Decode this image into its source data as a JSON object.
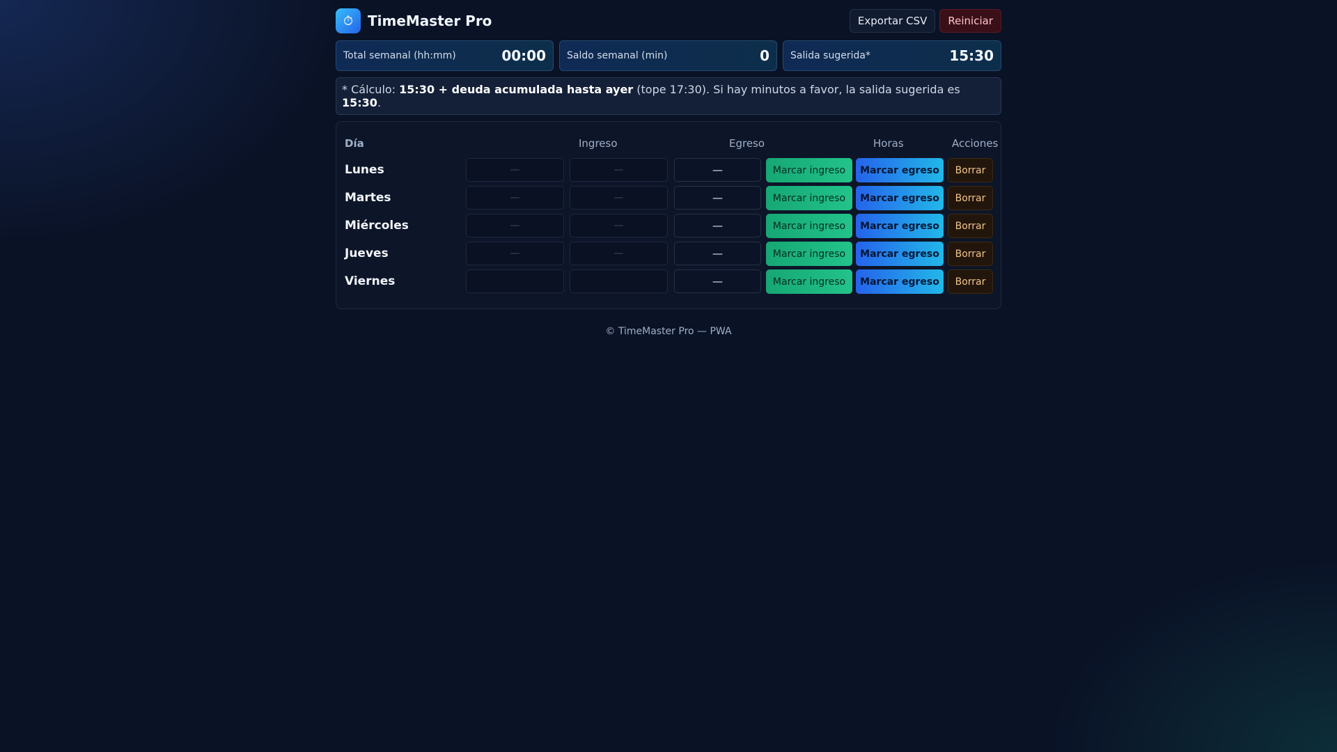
{
  "app": {
    "title": "TimeMaster Pro",
    "logo_icon": "stopwatch-icon",
    "logo_glyph": "⏱"
  },
  "header": {
    "export_label": "Exportar CSV",
    "reset_label": "Reiniciar"
  },
  "stats": [
    {
      "label": "Total semanal (hh:mm)",
      "value": "00:00"
    },
    {
      "label": "Saldo semanal (min)",
      "value": "0"
    },
    {
      "label": "Salida sugerida*",
      "value": "15:30"
    }
  ],
  "note": {
    "prefix": "* Cálculo: ",
    "bold1": "15:30 + deuda acumulada hasta ayer",
    "middle": " (tope 17:30). Si hay minutos a favor, la salida sugerida es ",
    "bold2": "15:30",
    "suffix": "."
  },
  "table": {
    "headers": {
      "dia": "Día",
      "ingreso": "Ingreso",
      "egreso": "Egreso",
      "horas": "Horas",
      "acciones": "Acciones"
    },
    "rows": [
      {
        "day": "Lunes",
        "ingreso": "—",
        "egreso": "—",
        "horas": "—"
      },
      {
        "day": "Martes",
        "ingreso": "—",
        "egreso": "—",
        "horas": "—"
      },
      {
        "day": "Miércoles",
        "ingreso": "—",
        "egreso": "—",
        "horas": "—"
      },
      {
        "day": "Jueves",
        "ingreso": "—",
        "egreso": "—",
        "horas": "—"
      },
      {
        "day": "Viernes",
        "ingreso": "",
        "egreso": "",
        "horas": "—"
      }
    ],
    "actions": {
      "mark_in": "Marcar ingreso",
      "mark_out": "Marcar egreso",
      "delete": "Borrar"
    }
  },
  "footer": {
    "text": "© TimeMaster Pro — PWA"
  },
  "colors": {
    "background": "#0a1226",
    "mark_in": "#22c38a",
    "mark_out": "#2563eb",
    "delete": "#22160c",
    "reset": "#3a0f18"
  }
}
